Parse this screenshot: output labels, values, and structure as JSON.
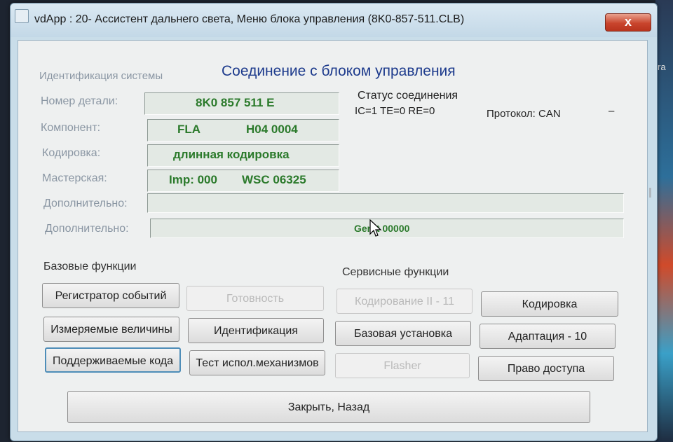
{
  "window": {
    "title": "vdApp : 20- Ассистент дальнего света,  Меню блока управления (8K0-857-511.CLB)",
    "close_symbol": "x"
  },
  "desktop": {
    "edge_text": "ra"
  },
  "identification": {
    "group_title": "Идентификация системы",
    "main_title": "Соединение с блоком управления",
    "part_number": {
      "label": "Номер детали:",
      "value": "8K0 857 511 E"
    },
    "component": {
      "label": "Компонент:",
      "value_a": "FLA",
      "value_b": "H04 0004"
    },
    "coding": {
      "label": "Кодировка:",
      "value": "длинная кодировка"
    },
    "workshop": {
      "label": "Мастерская:",
      "value_a": "Imp: 000",
      "value_b": "WSC 06325"
    },
    "extra1": {
      "label": "Дополнительно:",
      "value": ""
    },
    "extra2": {
      "label": "Дополнительно:",
      "value": "Gerat 00000"
    }
  },
  "status": {
    "title": "Статус соединения",
    "values": "IC=1  TE=0  RE=0",
    "protocol": "Протокол: CAN",
    "dash": "–"
  },
  "basic_functions": {
    "title": "Базовые функции",
    "event_recorder": "Регистратор событий",
    "readiness": "Готовность",
    "measured_values": "Измеряемые величины",
    "identification": "Идентификация",
    "supported_codes": "Поддерживаемые кода",
    "actuator_test": "Тест испол.механизмов"
  },
  "service_functions": {
    "title": "Сервисные функции",
    "coding_ii": "Кодирование II - 11",
    "coding": "Кодировка",
    "basic_setting": "Базовая установка",
    "adaptation": "Адаптация - 10",
    "flasher": "Flasher",
    "access_rights": "Право доступа"
  },
  "footer": {
    "close_back": "Закрыть, Назад"
  },
  "colors": {
    "value_green": "#2b7a2b",
    "title_blue": "#1c3a8c",
    "label_gray": "#8a96a3"
  }
}
